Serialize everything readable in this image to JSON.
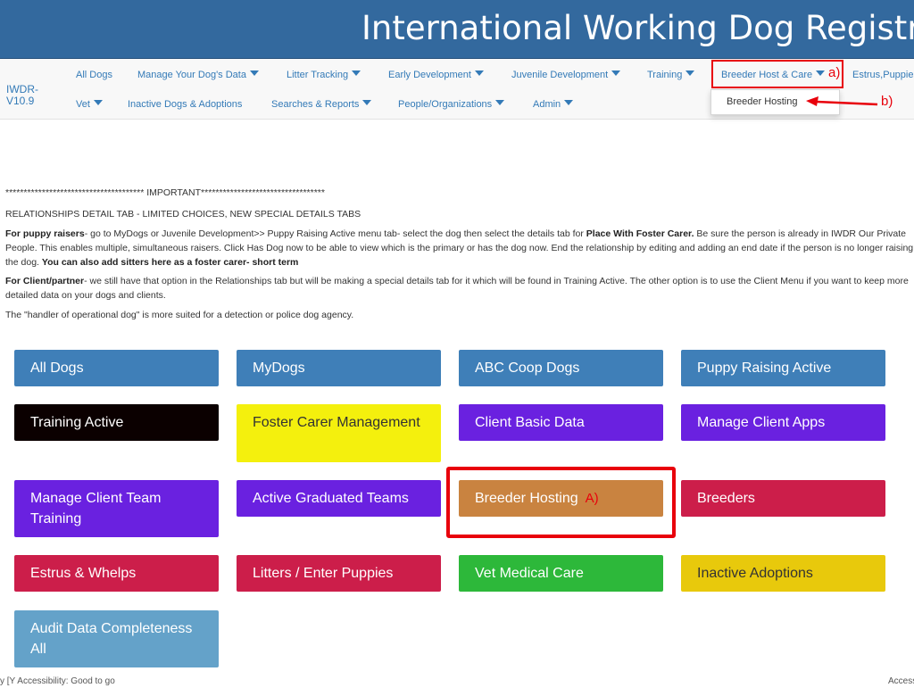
{
  "header": {
    "title": "International Working Dog Registry"
  },
  "navbar": {
    "brand": "IWDR-V10.9",
    "row1": [
      {
        "label": "All Dogs",
        "caret": false
      },
      {
        "label": "Manage Your Dog's Data",
        "caret": true
      },
      {
        "label": "Litter Tracking",
        "caret": true
      },
      {
        "label": "Early Development",
        "caret": true
      },
      {
        "label": "Juvenile Development",
        "caret": true
      },
      {
        "label": "Training",
        "caret": true
      },
      {
        "label": "Breeder Host & Care",
        "caret": true
      },
      {
        "label": "Estrus,Puppies",
        "caret": false
      }
    ],
    "row2": [
      {
        "label": "Vet",
        "caret": true
      },
      {
        "label": "Inactive Dogs & Adoptions",
        "caret": false
      },
      {
        "label": "Searches & Reports",
        "caret": true
      },
      {
        "label": "People/Organizations",
        "caret": true
      },
      {
        "label": "Admin",
        "caret": true
      }
    ],
    "dropdown": {
      "items": [
        "Breeder Hosting"
      ]
    }
  },
  "annotations": {
    "nav_a": "a)",
    "nav_b": "b)",
    "tile_a": "A)"
  },
  "notes": {
    "important": "************************************** IMPORTANT**********************************",
    "heading": "RELATIONSHIPS DETAIL TAB  - LIMITED CHOICES,  NEW SPECIAL DETAILS TABS",
    "puppy": {
      "bold1": "For puppy raisers",
      "text1": "- go to MyDogs or Juvenile Development>> Puppy Raising Active menu tab-  select the dog then select the details tab for ",
      "bold2": "Place With Foster Carer.",
      "text2": "  Be sure the person is already in IWDR Our Private People.  This enables multiple, simultaneous raisers.  Click Has Dog now to be able to view which is the primary or has the dog now.  End the relationship by editing and adding an end date if the person is no longer raising the dog.  ",
      "bold3": "You can also add sitters here as a foster carer- short term"
    },
    "client": {
      "bold1": "For Client/partner",
      "text1": "- we still have that option in the Relationships tab but will be making a special details tab for it which will be found in Training Active.  The other option is to use the Client Menu if you want to keep more detailed data on your dogs and clients."
    },
    "handler": "The \"handler of operational dog\" is more suited for a detection or police dog agency."
  },
  "tiles": [
    {
      "label": "All Dogs",
      "color": "#3f7fb8"
    },
    {
      "label": "MyDogs",
      "color": "#3f7fb8"
    },
    {
      "label": "ABC Coop Dogs",
      "color": "#3f7fb8"
    },
    {
      "label": "Puppy Raising Active",
      "color": "#3f7fb8"
    },
    {
      "label": "Training Active",
      "color": "#0b0000"
    },
    {
      "label": "Foster Carer Management",
      "color": "#f4f00d"
    },
    {
      "label": "Client Basic Data",
      "color": "#6a21e0"
    },
    {
      "label": "Manage Client Apps",
      "color": "#6a21e0"
    },
    {
      "label": "Manage Client Team Training",
      "color": "#6a21e0"
    },
    {
      "label": "Active Graduated Teams",
      "color": "#6a21e0"
    },
    {
      "label": "Breeder Hosting",
      "color": "#c98340"
    },
    {
      "label": "Breeders",
      "color": "#cc1e4a"
    },
    {
      "label": "Estrus & Whelps",
      "color": "#cc1e4a"
    },
    {
      "label": "Litters / Enter Puppies",
      "color": "#cc1e4a"
    },
    {
      "label": "Vet Medical Care",
      "color": "#2db83a"
    },
    {
      "label": "Inactive Adoptions",
      "color": "#e8c90c"
    },
    {
      "label": "Audit Data Completeness All",
      "color": "#64a2c9"
    }
  ],
  "footer": {
    "cut_off_text": "y   [Y  Accessibility: Good to go",
    "cut_off_right": "Accessi"
  }
}
